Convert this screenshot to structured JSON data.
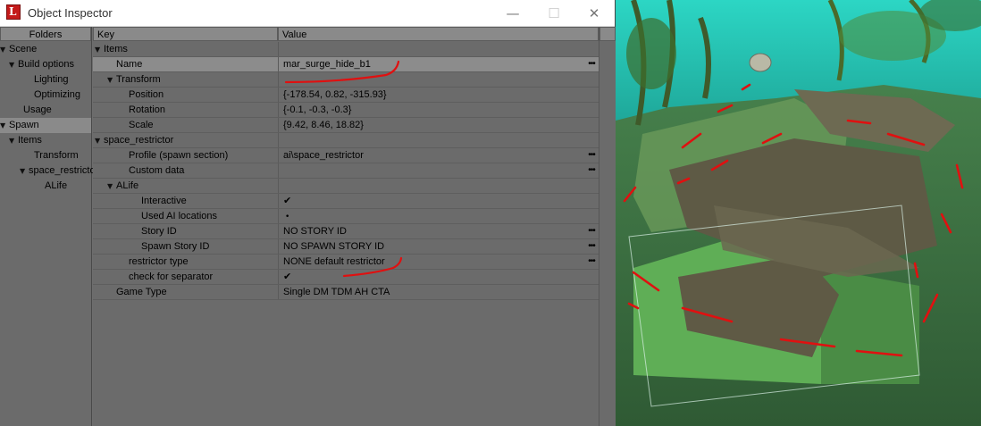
{
  "window": {
    "title": "Object Inspector",
    "app_icon_letter": "L",
    "minimize_glyph": "—",
    "maximize_glyph": "☐",
    "close_glyph": "✕"
  },
  "folders": {
    "header": "Folders",
    "items": [
      {
        "label": "Scene",
        "expander": "▼",
        "selected": false
      },
      {
        "label": "Build options",
        "expander": "▼",
        "selected": false
      },
      {
        "label": "Lighting",
        "expander": "",
        "selected": false
      },
      {
        "label": "Optimizing",
        "expander": "",
        "selected": false
      },
      {
        "label": "Usage",
        "expander": "",
        "selected": false
      },
      {
        "label": "Spawn",
        "expander": "▼",
        "selected": true
      },
      {
        "label": "Items",
        "expander": "▼",
        "selected": false
      },
      {
        "label": "Transform",
        "expander": "",
        "selected": false
      },
      {
        "label": "space_restrictor",
        "expander": "▼",
        "selected": false
      },
      {
        "label": "ALife",
        "expander": "",
        "selected": false
      }
    ]
  },
  "grid": {
    "header_key": "Key",
    "header_value": "Value",
    "rows": [
      {
        "key": "Items",
        "value": "",
        "expander": "▼",
        "dots": ""
      },
      {
        "key": "Name",
        "value": "mar_surge_hide_b1",
        "expander": "",
        "dots": "•••"
      },
      {
        "key": "Transform",
        "value": "",
        "expander": "▼",
        "dots": ""
      },
      {
        "key": "Position",
        "value": "{-178.54, 0.82, -315.93}",
        "expander": "",
        "dots": ""
      },
      {
        "key": "Rotation",
        "value": "{-0.1, -0.3, -0.3}",
        "expander": "",
        "dots": ""
      },
      {
        "key": "Scale",
        "value": "{9.42, 8.46, 18.82}",
        "expander": "",
        "dots": ""
      },
      {
        "key": "space_restrictor",
        "value": "",
        "expander": "▼",
        "dots": ""
      },
      {
        "key": "Profile (spawn section)",
        "value": "ai\\space_restrictor",
        "expander": "",
        "dots": "•••"
      },
      {
        "key": "Custom data",
        "value": "",
        "expander": "",
        "dots": "•••"
      },
      {
        "key": "ALife",
        "value": "",
        "expander": "▼",
        "dots": ""
      },
      {
        "key": "Interactive",
        "value": "✔",
        "expander": "",
        "dots": ""
      },
      {
        "key": "Used AI locations",
        "value": "•",
        "expander": "",
        "dots": ""
      },
      {
        "key": "Story ID",
        "value": "NO STORY ID",
        "expander": "",
        "dots": "•••"
      },
      {
        "key": "Spawn Story ID",
        "value": "NO SPAWN STORY ID",
        "expander": "",
        "dots": "•••"
      },
      {
        "key": "restrictor type",
        "value": "NONE default restrictor",
        "expander": "",
        "dots": "•••"
      },
      {
        "key": "check for separator",
        "value": "✔",
        "expander": "",
        "dots": ""
      },
      {
        "key": "Game Type",
        "value": "Single DM TDM AH CTA",
        "expander": "",
        "dots": ""
      }
    ]
  },
  "colors": {
    "panel": "#6b6b6b",
    "header": "#8a8a8a",
    "annotation_red": "#e01010",
    "viewport_sky": "#2bd0c0",
    "viewport_ground": "#5aa04a"
  }
}
